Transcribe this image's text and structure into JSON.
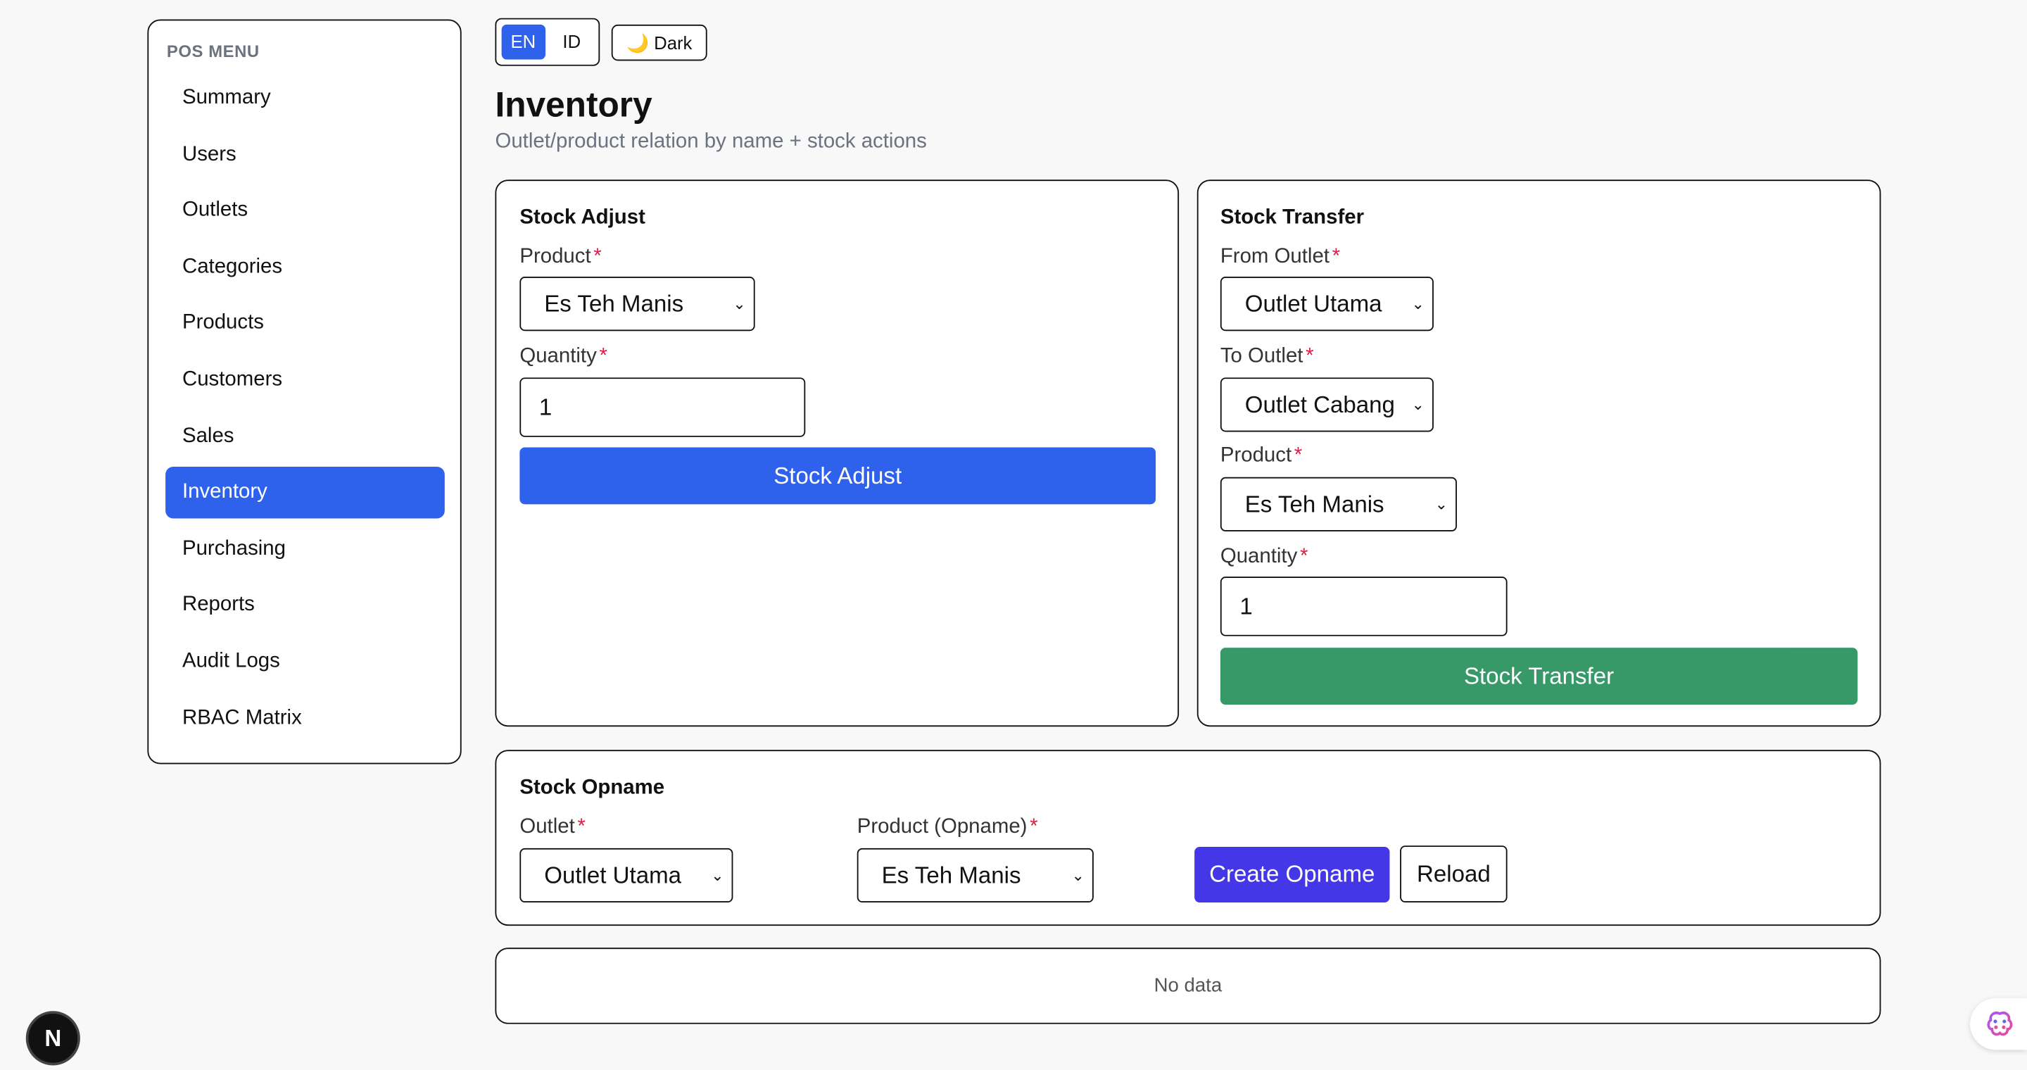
{
  "sidebar": {
    "title": "POS MENU",
    "items": [
      {
        "label": "Summary"
      },
      {
        "label": "Users"
      },
      {
        "label": "Outlets"
      },
      {
        "label": "Categories"
      },
      {
        "label": "Products"
      },
      {
        "label": "Customers"
      },
      {
        "label": "Sales"
      },
      {
        "label": "Inventory",
        "active": true
      },
      {
        "label": "Purchasing"
      },
      {
        "label": "Reports"
      },
      {
        "label": "Audit Logs"
      },
      {
        "label": "RBAC Matrix"
      }
    ]
  },
  "topbar": {
    "lang_en": "EN",
    "lang_id": "ID",
    "dark_label": "🌙 Dark"
  },
  "page": {
    "title": "Inventory",
    "subtitle": "Outlet/product relation by name + stock actions"
  },
  "stock_adjust": {
    "title": "Stock Adjust",
    "product_label": "Product",
    "product_value": "Es Teh Manis",
    "quantity_label": "Quantity",
    "quantity_value": "1",
    "button": "Stock Adjust"
  },
  "stock_transfer": {
    "title": "Stock Transfer",
    "from_label": "From Outlet",
    "from_value": "Outlet Utama",
    "to_label": "To Outlet",
    "to_value": "Outlet Cabang",
    "product_label": "Product",
    "product_value": "Es Teh Manis",
    "quantity_label": "Quantity",
    "quantity_value": "1",
    "button": "Stock Transfer"
  },
  "stock_opname": {
    "title": "Stock Opname",
    "outlet_label": "Outlet",
    "outlet_value": "Outlet Utama",
    "product_label": "Product (Opname)",
    "product_value": "Es Teh Manis",
    "create_button": "Create Opname",
    "reload_button": "Reload"
  },
  "table": {
    "empty": "No data"
  },
  "badges": {
    "next": "N"
  },
  "required_mark": "*",
  "colors": {
    "primary": "#2f62ec",
    "success": "#379868",
    "indigo": "#4337e8",
    "required": "#e11d48"
  }
}
